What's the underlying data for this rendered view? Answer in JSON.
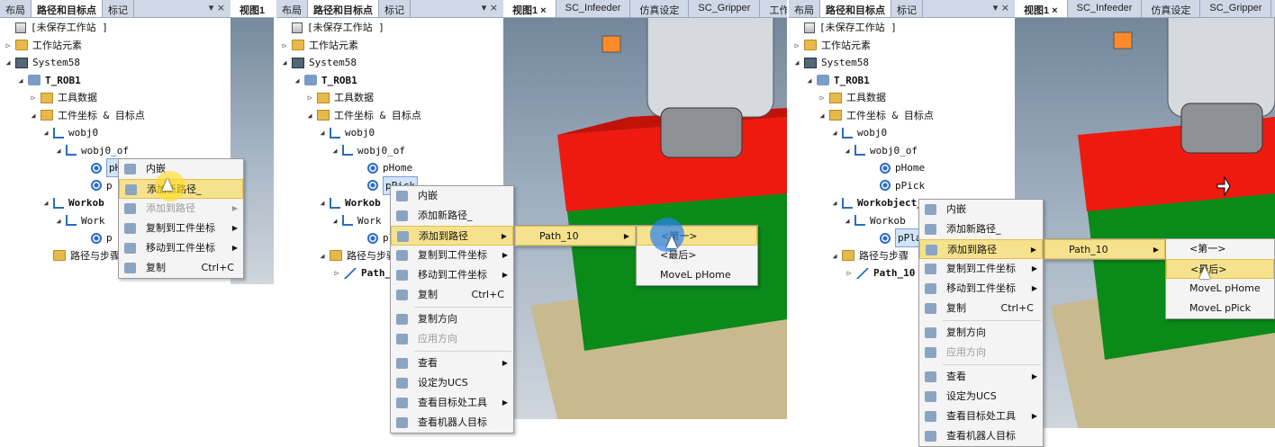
{
  "panel1": {
    "tabs": [
      "布局",
      "路径和目标点",
      "标记"
    ],
    "tab_ctl": "▾ ×",
    "view_tab": "视图1",
    "tree": [
      {
        "label": "[未保存工作站 ]",
        "arrow": "",
        "icon": "station",
        "bold": false
      },
      {
        "label": "工作站元素",
        "arrow": "▷",
        "icon": "folder",
        "bold": false
      },
      {
        "label": "System58",
        "arrow": "◢",
        "icon": "system",
        "bold": false
      },
      {
        "label": "T_ROB1",
        "arrow": "◢",
        "icon": "robot",
        "bold": true
      },
      {
        "label": "工具数据",
        "arrow": "▷",
        "icon": "tool",
        "bold": false
      },
      {
        "label": "工件坐标 & 目标点",
        "arrow": "◢",
        "icon": "tool",
        "bold": false
      },
      {
        "label": "wobj0",
        "arrow": "◢",
        "icon": "wobj",
        "bold": false
      },
      {
        "label": "wobj0_of",
        "arrow": "◢",
        "icon": "wobj",
        "bold": false
      },
      {
        "label": "pH",
        "arrow": "",
        "icon": "target",
        "bold": false
      },
      {
        "label": "p",
        "arrow": "",
        "icon": "target",
        "bold": false
      },
      {
        "label": "Workob",
        "arrow": "◢",
        "icon": "wobj",
        "bold": true
      },
      {
        "label": "Work",
        "arrow": "◢",
        "icon": "wobj",
        "bold": false
      },
      {
        "label": "p",
        "arrow": "",
        "icon": "target",
        "bold": false
      },
      {
        "label": "路径与步骤",
        "arrow": "",
        "icon": "folder",
        "bold": false
      }
    ],
    "menu": [
      {
        "label": "内嵌",
        "shortcut": "",
        "sub": false,
        "state": ""
      },
      {
        "label": "添加新路径_",
        "shortcut": "",
        "sub": false,
        "state": "hl"
      },
      {
        "label": "添加到路径",
        "shortcut": "",
        "sub": true,
        "state": "dis"
      },
      {
        "label": "复制到工件坐标",
        "shortcut": "",
        "sub": true,
        "state": ""
      },
      {
        "label": "移动到工件坐标",
        "shortcut": "",
        "sub": true,
        "state": ""
      },
      {
        "label": "复制",
        "shortcut": "Ctrl+C",
        "sub": false,
        "state": ""
      }
    ]
  },
  "panel2": {
    "tabs": [
      "布局",
      "路径和目标点",
      "标记"
    ],
    "tab_ctl": "▾ ×",
    "view_tabs": [
      "视图1 ×",
      "SC_Infeeder",
      "仿真设定",
      "SC_Gripper",
      "工作"
    ],
    "tree": [
      {
        "label": "[未保存工作站 ]",
        "arrow": "",
        "icon": "station",
        "bold": false
      },
      {
        "label": "工作站元素",
        "arrow": "▷",
        "icon": "folder",
        "bold": false
      },
      {
        "label": "System58",
        "arrow": "◢",
        "icon": "system",
        "bold": false
      },
      {
        "label": "T_ROB1",
        "arrow": "◢",
        "icon": "robot",
        "bold": true
      },
      {
        "label": "工具数据",
        "arrow": "▷",
        "icon": "tool",
        "bold": false
      },
      {
        "label": "工件坐标 & 目标点",
        "arrow": "◢",
        "icon": "tool",
        "bold": false
      },
      {
        "label": "wobj0",
        "arrow": "◢",
        "icon": "wobj",
        "bold": false
      },
      {
        "label": "wobj0_of",
        "arrow": "◢",
        "icon": "wobj",
        "bold": false
      },
      {
        "label": "pHome",
        "arrow": "",
        "icon": "target",
        "bold": false
      },
      {
        "label": "pPick",
        "arrow": "",
        "icon": "target",
        "bold": false
      },
      {
        "label": "Workob",
        "arrow": "◢",
        "icon": "wobj",
        "bold": true
      },
      {
        "label": "Work",
        "arrow": "◢",
        "icon": "wobj",
        "bold": false
      },
      {
        "label": "pl",
        "arrow": "",
        "icon": "target",
        "bold": false
      },
      {
        "label": "路径与步骤",
        "arrow": "◢",
        "icon": "folder",
        "bold": false
      },
      {
        "label": "Path_1",
        "arrow": "▷",
        "icon": "path",
        "bold": true
      }
    ],
    "menu": [
      {
        "label": "内嵌",
        "shortcut": "",
        "sub": false,
        "state": ""
      },
      {
        "label": "添加新路径_",
        "shortcut": "",
        "sub": false,
        "state": ""
      },
      {
        "label": "添加到路径",
        "shortcut": "",
        "sub": true,
        "state": "hl"
      },
      {
        "label": "复制到工件坐标",
        "shortcut": "",
        "sub": true,
        "state": ""
      },
      {
        "label": "移动到工件坐标",
        "shortcut": "",
        "sub": true,
        "state": ""
      },
      {
        "label": "复制",
        "shortcut": "Ctrl+C",
        "sub": false,
        "state": ""
      },
      {
        "label": "复制方向",
        "shortcut": "",
        "sub": false,
        "state": ""
      },
      {
        "label": "应用方向",
        "shortcut": "",
        "sub": false,
        "state": "dis"
      },
      {
        "label": "查看",
        "shortcut": "",
        "sub": true,
        "state": ""
      },
      {
        "label": "设定为UCS",
        "shortcut": "",
        "sub": false,
        "state": ""
      },
      {
        "label": "查看目标处工具",
        "shortcut": "",
        "sub": true,
        "state": ""
      },
      {
        "label": "查看机器人目标",
        "shortcut": "",
        "sub": false,
        "state": ""
      }
    ],
    "submenu1": [
      "Path_10"
    ],
    "submenu2": [
      "<第一>",
      "<最后>",
      "MoveL pHome"
    ]
  },
  "panel3": {
    "tabs": [
      "布局",
      "路径和目标点",
      "标记"
    ],
    "tab_ctl": "▾ ×",
    "view_tabs": [
      "视图1 ×",
      "SC_Infeeder",
      "仿真设定",
      "SC_Gripper"
    ],
    "tree": [
      {
        "label": "[未保存工作站 ]",
        "arrow": "",
        "icon": "station",
        "bold": false
      },
      {
        "label": "工作站元素",
        "arrow": "▷",
        "icon": "folder",
        "bold": false
      },
      {
        "label": "System58",
        "arrow": "◢",
        "icon": "system",
        "bold": false
      },
      {
        "label": "T_ROB1",
        "arrow": "◢",
        "icon": "robot",
        "bold": true
      },
      {
        "label": "工具数据",
        "arrow": "▷",
        "icon": "tool",
        "bold": false
      },
      {
        "label": "工件坐标 & 目标点",
        "arrow": "◢",
        "icon": "tool",
        "bold": false
      },
      {
        "label": "wobj0",
        "arrow": "◢",
        "icon": "wobj",
        "bold": false
      },
      {
        "label": "wobj0_of",
        "arrow": "◢",
        "icon": "wobj",
        "bold": false
      },
      {
        "label": "pHome",
        "arrow": "",
        "icon": "target",
        "bold": false
      },
      {
        "label": "pPick",
        "arrow": "",
        "icon": "target",
        "bold": false
      },
      {
        "label": "Workobject_1",
        "arrow": "◢",
        "icon": "wobj",
        "bold": true
      },
      {
        "label": "Workob",
        "arrow": "◢",
        "icon": "wobj",
        "bold": false
      },
      {
        "label": "pPla",
        "arrow": "",
        "icon": "target",
        "bold": false
      },
      {
        "label": "路径与步骤",
        "arrow": "◢",
        "icon": "folder",
        "bold": false
      },
      {
        "label": "Path_10",
        "arrow": "▷",
        "icon": "path",
        "bold": true
      }
    ],
    "menu": [
      {
        "label": "内嵌",
        "shortcut": "",
        "sub": false,
        "state": ""
      },
      {
        "label": "添加新路径_",
        "shortcut": "",
        "sub": false,
        "state": ""
      },
      {
        "label": "添加到路径",
        "shortcut": "",
        "sub": true,
        "state": "hl"
      },
      {
        "label": "复制到工件坐标",
        "shortcut": "",
        "sub": true,
        "state": ""
      },
      {
        "label": "移动到工件坐标",
        "shortcut": "",
        "sub": true,
        "state": ""
      },
      {
        "label": "复制",
        "shortcut": "Ctrl+C",
        "sub": false,
        "state": ""
      },
      {
        "label": "复制方向",
        "shortcut": "",
        "sub": false,
        "state": ""
      },
      {
        "label": "应用方向",
        "shortcut": "",
        "sub": false,
        "state": "dis"
      },
      {
        "label": "查看",
        "shortcut": "",
        "sub": true,
        "state": ""
      },
      {
        "label": "设定为UCS",
        "shortcut": "",
        "sub": false,
        "state": ""
      },
      {
        "label": "查看目标处工具",
        "shortcut": "",
        "sub": true,
        "state": ""
      },
      {
        "label": "查看机器人目标",
        "shortcut": "",
        "sub": false,
        "state": ""
      }
    ],
    "submenu1": [
      "Path_10"
    ],
    "submenu2": [
      "<第一>",
      "<最后>",
      "MoveL pHome",
      "MoveL pPick"
    ]
  },
  "colors": {
    "red_block": "#ee1a0f",
    "green_block": "#0a8a18",
    "tan_base": "#c9b98f",
    "menu_highlight": "#f6e28c"
  }
}
